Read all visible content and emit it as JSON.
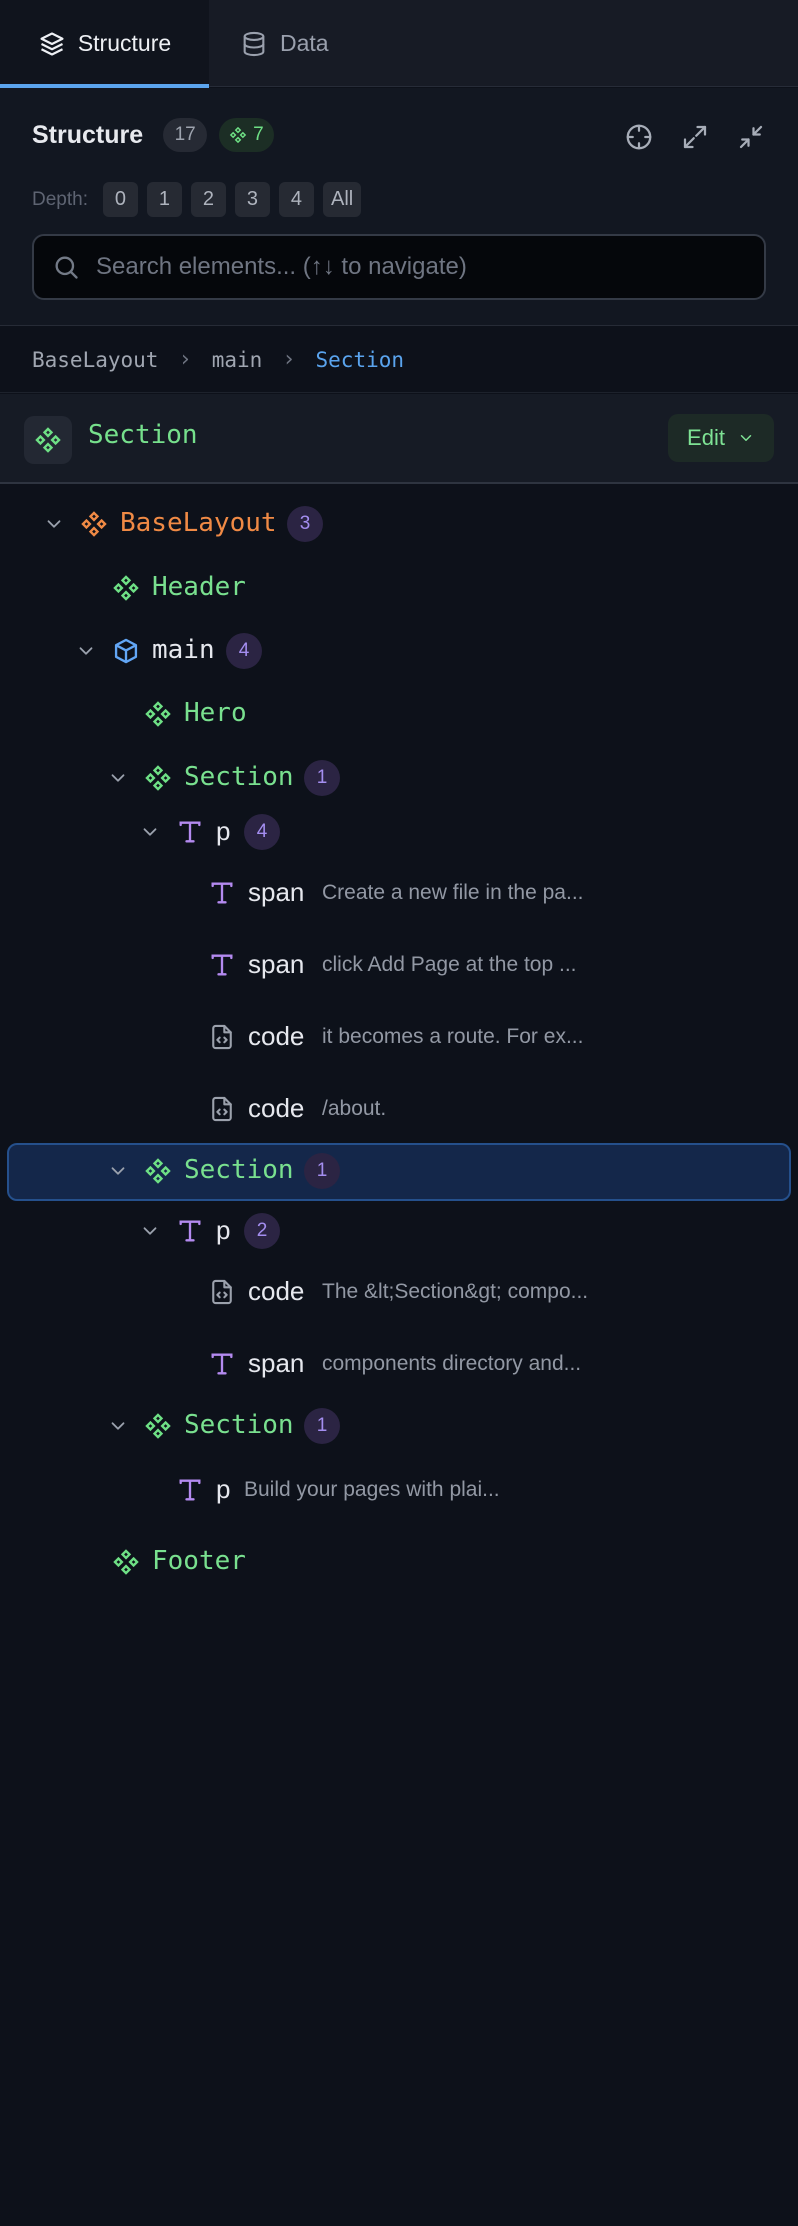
{
  "tabs": [
    {
      "label": "Structure",
      "icon": "layers-icon",
      "active": true
    },
    {
      "label": "Data",
      "icon": "database-icon",
      "active": false
    }
  ],
  "header": {
    "title": "Structure",
    "element_count": "17",
    "component_count": "7",
    "depth_label": "Depth:",
    "depth_options": [
      "0",
      "1",
      "2",
      "3",
      "4",
      "All"
    ],
    "search_placeholder": "Search elements... (↑↓ to navigate)"
  },
  "breadcrumb": [
    "BaseLayout",
    "main",
    "Section"
  ],
  "selected": {
    "name": "Section",
    "edit_label": "Edit"
  },
  "tree": [
    {
      "label": "BaseLayout",
      "kind": "component-root",
      "count": "3",
      "expanded": true
    },
    {
      "label": "Header",
      "kind": "component"
    },
    {
      "label": "main",
      "kind": "element",
      "count": "4",
      "expanded": true
    },
    {
      "label": "Hero",
      "kind": "component"
    },
    {
      "label": "Section",
      "kind": "component",
      "count": "1",
      "expanded": true
    },
    {
      "label": "p",
      "kind": "text",
      "count": "4",
      "expanded": true
    },
    {
      "label": "span",
      "kind": "text",
      "preview": "Create a new file in the pa..."
    },
    {
      "label": "span",
      "kind": "text",
      "preview": "click Add Page at the top ..."
    },
    {
      "label": "code",
      "kind": "code",
      "preview": "it becomes a route. For ex..."
    },
    {
      "label": "code",
      "kind": "code",
      "preview": "/about."
    },
    {
      "label": "Section",
      "kind": "component",
      "count": "1",
      "expanded": true,
      "selected": true
    },
    {
      "label": "p",
      "kind": "text",
      "count": "2",
      "expanded": true
    },
    {
      "label": "code",
      "kind": "code",
      "preview": "The &lt;Section&gt; compo..."
    },
    {
      "label": "span",
      "kind": "text",
      "preview": "components directory and..."
    },
    {
      "label": "Section",
      "kind": "component",
      "count": "1",
      "expanded": true
    },
    {
      "label": "p",
      "kind": "text",
      "preview": "Build your pages with plai..."
    },
    {
      "label": "Footer",
      "kind": "component"
    }
  ],
  "colors": {
    "accent": "#5ba4ee",
    "component": "#6ee085",
    "root": "#f08a45",
    "count_badge": "#a48ef0",
    "selection": "#14274a"
  }
}
